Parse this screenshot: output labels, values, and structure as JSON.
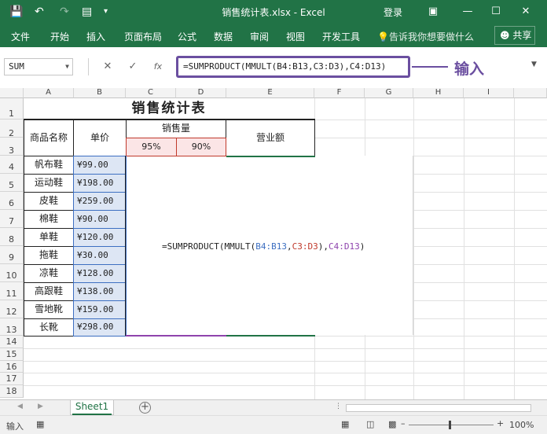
{
  "window": {
    "title": "销售统计表.xlsx - Excel",
    "login": "登录",
    "qa_icons": [
      "save-icon",
      "undo-icon",
      "redo-icon",
      "form-icon",
      "customize-icon"
    ],
    "buttons": [
      "ribbon-display-icon",
      "minimize-icon",
      "maximize-icon",
      "close-icon"
    ]
  },
  "ribbon": {
    "tabs": [
      "文件",
      "开始",
      "插入",
      "页面布局",
      "公式",
      "数据",
      "审阅",
      "视图",
      "开发工具"
    ],
    "tell_me": "告诉我你想要做什么",
    "share": "共享"
  },
  "formula_bar": {
    "name_box": "SUM",
    "formula": "=SUMPRODUCT(MMULT(B4:B13,C3:D3),C4:D13)",
    "annotation": "输入",
    "fx": "fx"
  },
  "grid": {
    "columns": [
      "A",
      "B",
      "C",
      "D",
      "E",
      "F",
      "G",
      "H",
      "I"
    ],
    "rows": [
      "1",
      "2",
      "3",
      "4",
      "5",
      "6",
      "7",
      "8",
      "9",
      "10",
      "11",
      "12",
      "13",
      "14",
      "15",
      "16",
      "17",
      "18"
    ]
  },
  "table": {
    "title": "销售统计表",
    "headers": {
      "product": "商品名称",
      "price": "单价",
      "sales": "销售量",
      "revenue": "营业额"
    },
    "pct": [
      "95%",
      "90%"
    ],
    "rows": [
      {
        "name": "帆布鞋",
        "price": "¥99.00"
      },
      {
        "name": "运动鞋",
        "price": "¥198.00"
      },
      {
        "name": "皮鞋",
        "price": "¥259.00"
      },
      {
        "name": "棉鞋",
        "price": "¥90.00"
      },
      {
        "name": "单鞋",
        "price": "¥120.00"
      },
      {
        "name": "拖鞋",
        "price": "¥30.00"
      },
      {
        "name": "凉鞋",
        "price": "¥128.00"
      },
      {
        "name": "高跟鞋",
        "price": "¥138.00"
      },
      {
        "name": "雪地靴",
        "price": "¥159.00"
      },
      {
        "name": "长靴",
        "price": "¥298.00"
      }
    ],
    "cell_formula": {
      "p1": "=SUMPRODUCT(MMULT(",
      "r1": "B4:B13",
      "c1": ",",
      "r2": "C3:D3",
      "p2": "),",
      "r3": "C4:D13",
      "p3": ")",
      "colors": {
        "r1": "#3d6fc1",
        "r2": "#c0392b",
        "r3": "#8e44ad"
      }
    }
  },
  "sheets": {
    "active": "Sheet1",
    "add_icon": "plus-circle-icon"
  },
  "status": {
    "mode": "输入",
    "zoom": "100%",
    "zoom_level": 1.0,
    "views": [
      "normal-view-icon",
      "page-layout-icon",
      "page-break-icon"
    ]
  }
}
